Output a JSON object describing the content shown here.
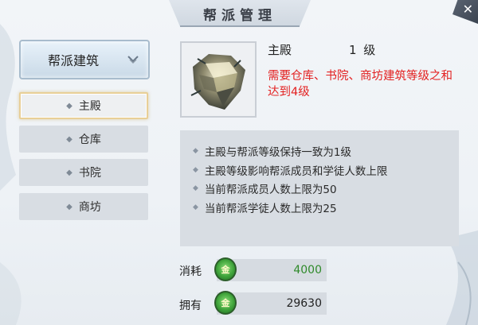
{
  "window": {
    "title": "帮派管理",
    "close_icon": "close-icon"
  },
  "sidebar": {
    "header_label": "帮派建筑",
    "header_icon": "chevron-down-icon",
    "items": [
      {
        "label": "主殿",
        "active": true
      },
      {
        "label": "仓库",
        "active": false
      },
      {
        "label": "书院",
        "active": false
      },
      {
        "label": "商坊",
        "active": false
      }
    ]
  },
  "building": {
    "name": "主殿",
    "level": "1 级",
    "requirement": "需要仓库、书院、商坊建筑等级之和达到4级",
    "icon": "main-hall-icon"
  },
  "info": {
    "lines": [
      "主殿与帮派等级保持一致为1级",
      "主殿等级影响帮派成员和学徒人数上限",
      "当前帮派成员人数上限为50",
      "当前帮派学徒人数上限为25"
    ]
  },
  "resources": {
    "cost_label": "消耗",
    "cost_value": "4000",
    "own_label": "拥有",
    "own_value": "29630",
    "currency_icon": "gold-coin-icon"
  },
  "colors": {
    "requirement": "#e32020",
    "cost_value": "#2f8a2a",
    "active_border": "#e8cf97"
  }
}
